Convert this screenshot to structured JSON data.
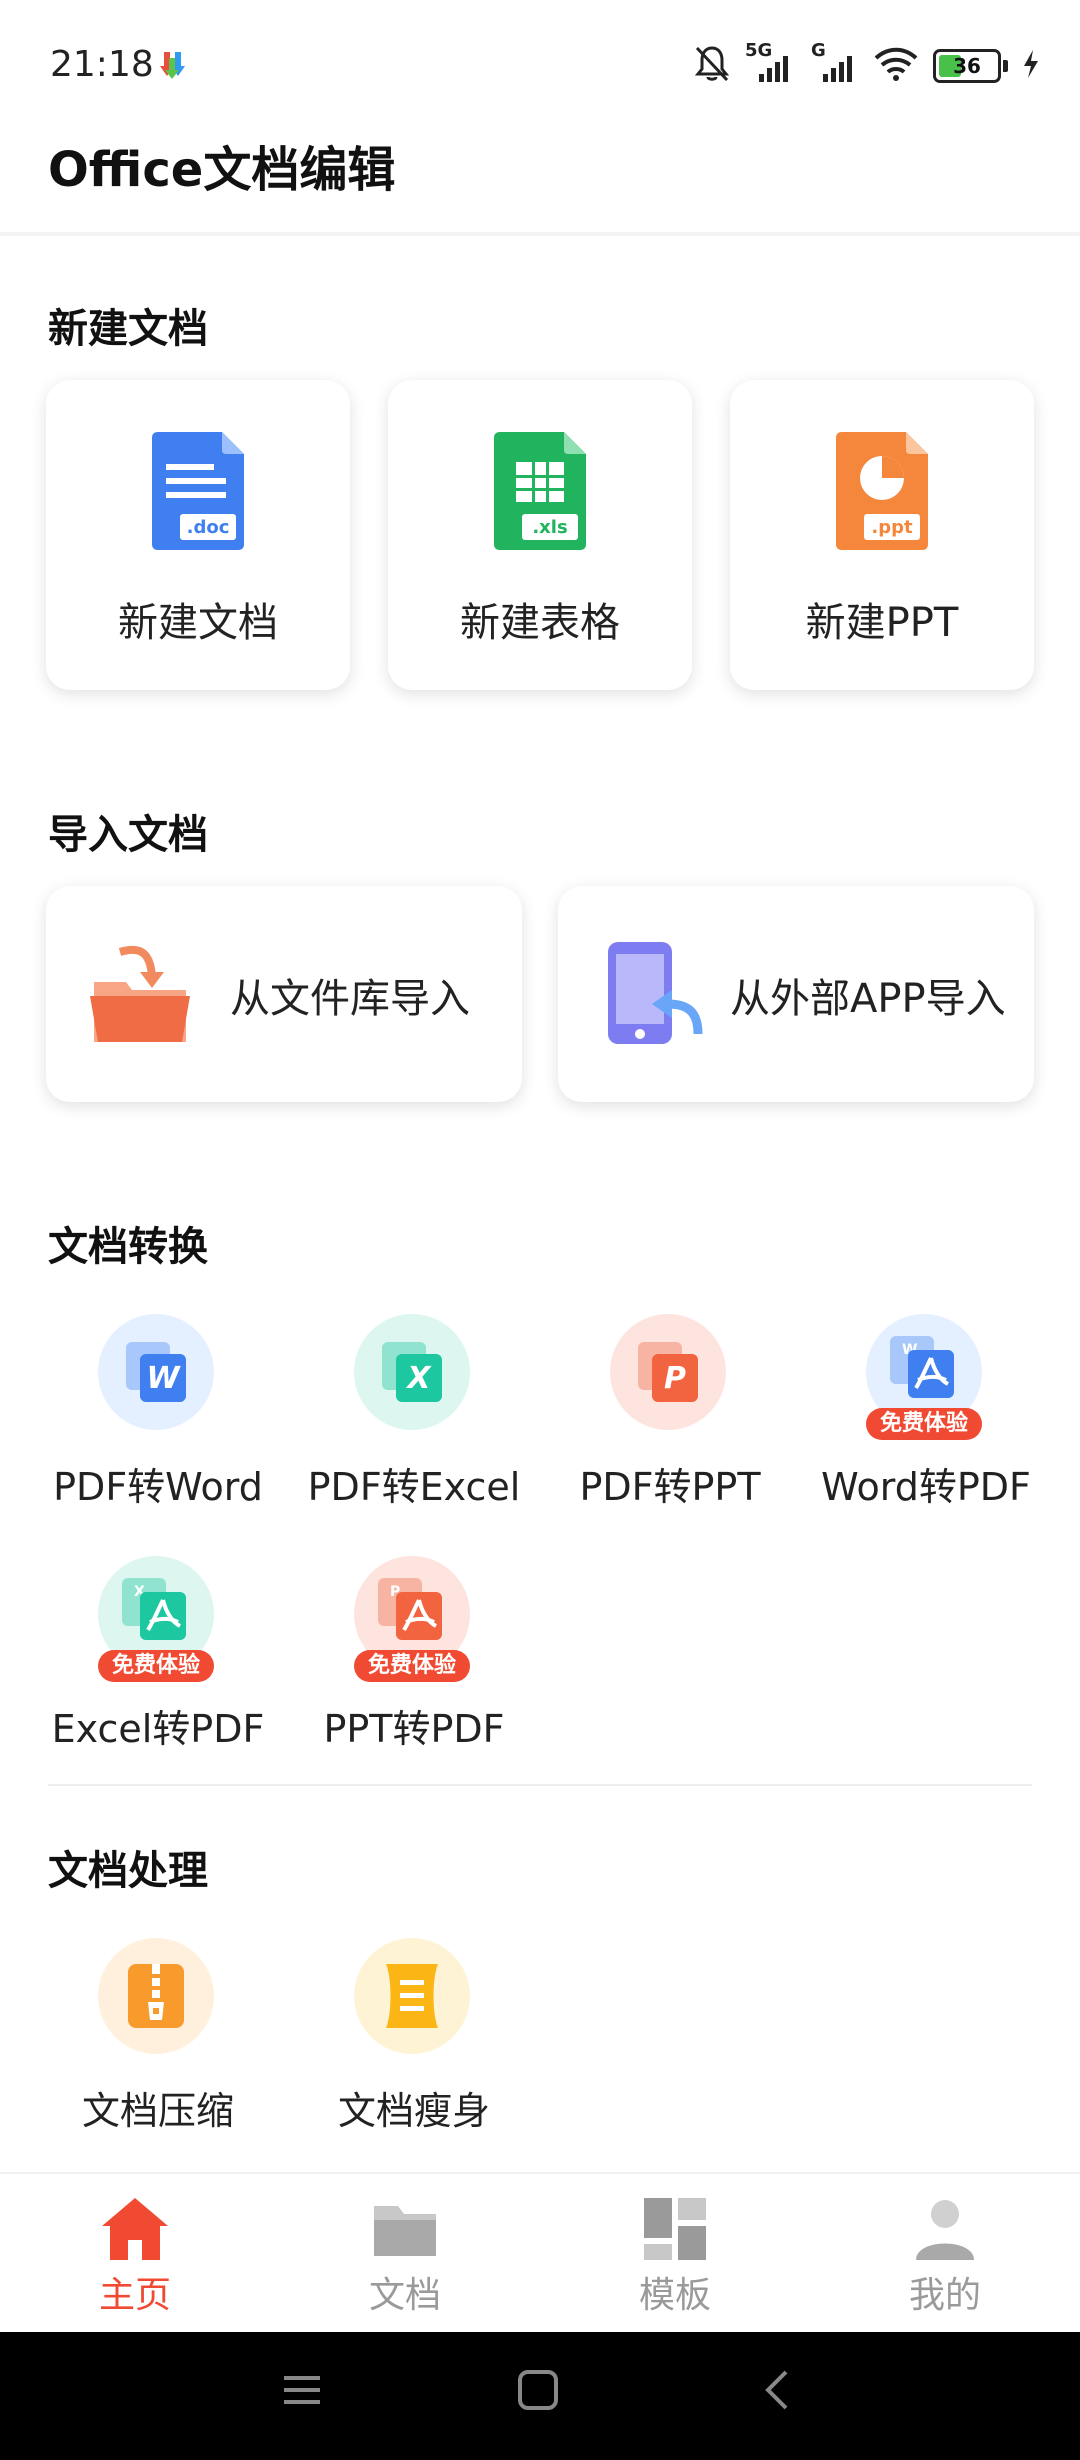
{
  "status_bar": {
    "time": "21:18",
    "signal_1": "5G",
    "signal_2": "G",
    "battery": "36"
  },
  "app": {
    "title": "Office文档编辑"
  },
  "new_docs": {
    "title": "新建文档",
    "items": [
      {
        "label": "新建文档",
        "ext": ".doc",
        "color": "#3f7ff0"
      },
      {
        "label": "新建表格",
        "ext": ".xls",
        "color": "#22b35e"
      },
      {
        "label": "新建PPT",
        "ext": ".ppt",
        "color": "#f5873c"
      }
    ]
  },
  "import": {
    "title": "导入文档",
    "items": [
      {
        "label": "从文件库导入"
      },
      {
        "label": "从外部APP导入"
      }
    ]
  },
  "convert": {
    "title": "文档转换",
    "badge": "免费体验",
    "items": [
      {
        "label": "PDF转Word",
        "letter": "W"
      },
      {
        "label": "PDF转Excel",
        "letter": "X"
      },
      {
        "label": "PDF转PPT",
        "letter": "P"
      },
      {
        "label": "Word转PDF",
        "letter": "W"
      },
      {
        "label": "Excel转PDF",
        "letter": "X"
      },
      {
        "label": "PPT转PDF",
        "letter": "P"
      }
    ]
  },
  "process": {
    "title": "文档处理",
    "items": [
      {
        "label": "文档压缩"
      },
      {
        "label": "文档瘦身"
      }
    ]
  },
  "bottom_nav": {
    "items": [
      {
        "label": "主页",
        "active": true
      },
      {
        "label": "文档"
      },
      {
        "label": "模板"
      },
      {
        "label": "我的"
      }
    ],
    "active_color": "#f04a33",
    "inactive_color": "#9a9a9a"
  }
}
